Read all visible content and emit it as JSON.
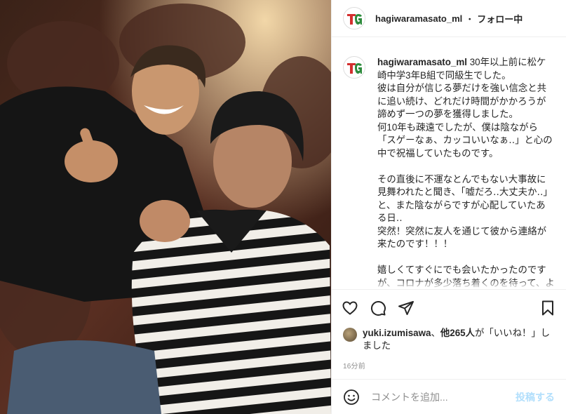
{
  "photo": {
    "alt": ""
  },
  "header": {
    "username": "hagiwaramasato_ml",
    "separator": "・",
    "follow_label": "フォロー中"
  },
  "caption": {
    "username": "hagiwaramasato_ml",
    "text": " 30年以上前に松ケ崎中学3年B組で同級生でした。\n彼は自分が信じる夢だけを強い信念と共に追い続け、どれだけ時間がかかろうが諦めず一つの夢を獲得しました。\n何10年も疎遠でしたが、僕は陰ながら「スゲーなぁ、カッコいいなぁ‥」と心の中で祝福していたものです。\n\nその直後に不運なとんでもない大事故に見舞われたと聞き、「嘘だろ‥大丈夫か‥」と、また陰ながらですが心配していたある日‥\n突然！突然に友人を通じて彼から連絡が来たのです！！！\n\n嬉しくてすぐにでも会いたかったのですが、コロナが多少落ち着くのを待って、ようやく今日が実現した運命\n"
  },
  "actions": {
    "like_icon": "heart-icon",
    "comment_icon": "comment-icon",
    "share_icon": "paper-plane-icon",
    "save_icon": "bookmark-icon"
  },
  "likes": {
    "user": "yuki.izumisawa",
    "middle": "、",
    "others": "他265人",
    "suffix": "が「いいね！」しました"
  },
  "timestamp": "16分前",
  "comment": {
    "emoji_icon": "smiley-icon",
    "placeholder": "コメントを追加...",
    "post_label": "投稿する"
  },
  "colors": {
    "post_disabled": "#b2dffc",
    "text": "#262626",
    "muted": "#8e8e8e",
    "logo_red": "#d32f2f",
    "logo_green": "#2e8b3d"
  }
}
